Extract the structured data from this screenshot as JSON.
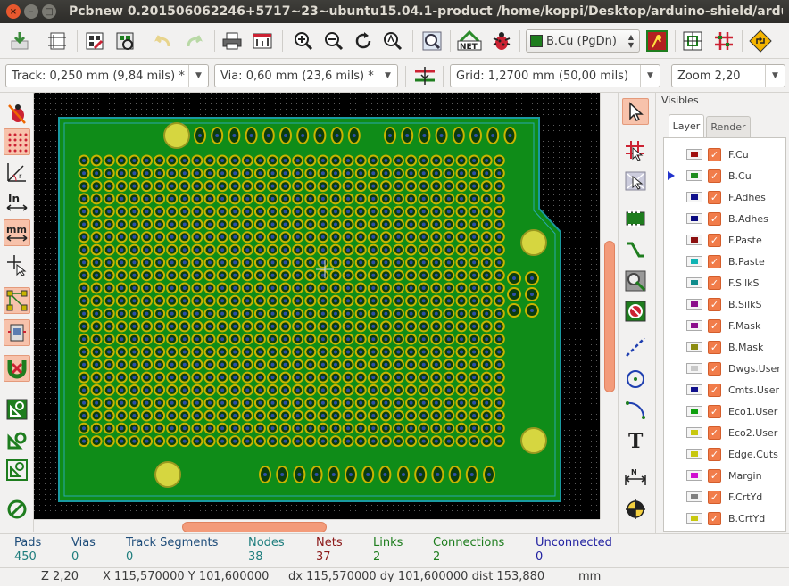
{
  "window": {
    "title": "Pcbnew 0.201506062246+5717~23~ubuntu15.04.1-product /home/koppi/Desktop/arduino-shield/arduino-shield.kicad_pcb",
    "close_glyph": "×",
    "min_glyph": "–",
    "max_glyph": "□"
  },
  "toolbar": {
    "layer_select": "B.Cu (PgDn)",
    "layer_select_color": "#1e7d1e",
    "icons": [
      "new-board-icon",
      "page-settings-icon",
      "board-setup-icon",
      "library-browser-icon",
      "undo-icon",
      "redo-icon",
      "print-icon",
      "plot-icon",
      "zoom-in-icon",
      "zoom-out-icon",
      "redraw-icon",
      "zoom-fit-icon",
      "find-icon",
      "netlist-icon",
      "drc-icon",
      "layer-pair-icon",
      "track-width-icon",
      "mode-track-icon",
      "mode-footprint-icon",
      "scripting-icon"
    ]
  },
  "toolbar2": {
    "track": "Track: 0,250 mm (9,84 mils) *",
    "via": "Via: 0,60 mm (23,6 mils) *",
    "grid": "Grid: 1,2700 mm (50,00 mils)",
    "zoom": "Zoom 2,20"
  },
  "visibles": {
    "title": "Visibles",
    "tabs": [
      "Layer",
      "Render"
    ],
    "layers": [
      {
        "name": "F.Cu",
        "color": "#a01010"
      },
      {
        "name": "B.Cu",
        "color": "#1e8c1e",
        "active": true
      },
      {
        "name": "F.Adhes",
        "color": "#10108c"
      },
      {
        "name": "B.Adhes",
        "color": "#0a0a80"
      },
      {
        "name": "F.Paste",
        "color": "#8c1010"
      },
      {
        "name": "B.Paste",
        "color": "#10b4b4"
      },
      {
        "name": "F.SilkS",
        "color": "#108c8c"
      },
      {
        "name": "B.SilkS",
        "color": "#8c108c"
      },
      {
        "name": "F.Mask",
        "color": "#8c108c"
      },
      {
        "name": "B.Mask",
        "color": "#8c8c10"
      },
      {
        "name": "Dwgs.User",
        "color": "#c8c8c8"
      },
      {
        "name": "Cmts.User",
        "color": "#10108c"
      },
      {
        "name": "Eco1.User",
        "color": "#10a010"
      },
      {
        "name": "Eco2.User",
        "color": "#c8c810"
      },
      {
        "name": "Edge.Cuts",
        "color": "#c8c810"
      },
      {
        "name": "Margin",
        "color": "#d010d0"
      },
      {
        "name": "F.CrtYd",
        "color": "#808080"
      },
      {
        "name": "B.CrtYd",
        "color": "#c8c810"
      }
    ]
  },
  "status": {
    "pads_label": "Pads",
    "pads": "450",
    "vias_label": "Vias",
    "vias": "0",
    "tracks_label": "Track Segments",
    "tracks": "0",
    "nodes_label": "Nodes",
    "nodes": "38",
    "nets_label": "Nets",
    "nets": "37",
    "links_label": "Links",
    "links": "2",
    "connections_label": "Connections",
    "connections": "2",
    "unconnected_label": "Unconnected",
    "unconnected": "0",
    "zoom": "Z 2,20",
    "coords": "X 115,570000  Y 101,600000",
    "delta": "dx 115,570000  dy 101,600000  dist 153,880",
    "units": "mm"
  },
  "colors": {
    "board_fill": "#0f8c18",
    "board_edge": "#1a9aa0",
    "pad_fill": "#c8b400",
    "mounting_hole": "#d6d640"
  }
}
